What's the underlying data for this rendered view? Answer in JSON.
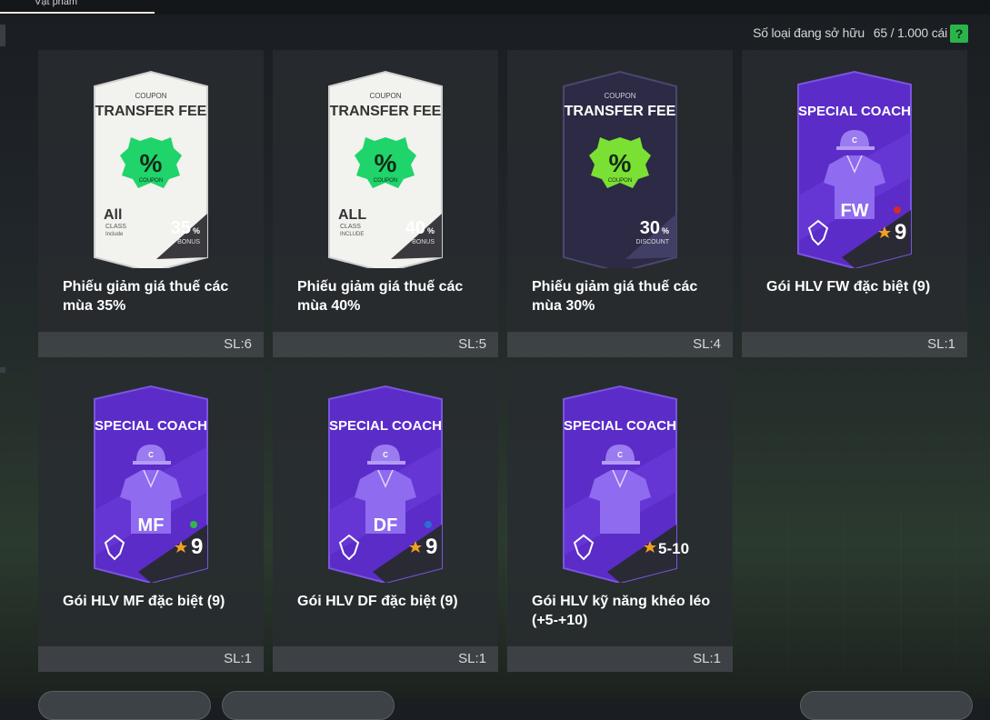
{
  "header": {
    "tab_label": "Vật phẩm"
  },
  "ownership": {
    "label": "Số loại đang sở hữu",
    "count": "65 / 1.000 cái",
    "help_label": "?"
  },
  "items": [
    {
      "title": "Phiếu giảm giá thuế các mùa 35%",
      "qty": "SL:6",
      "art": {
        "kind": "coupon",
        "header": "COUPON",
        "name": "TRANSFER FEE",
        "class_big": "All",
        "class_small": "CLASS",
        "class_small2": "Include",
        "percent": "35",
        "pct_sign": "%",
        "sub": "BONUS",
        "badge_text": "COUPON"
      }
    },
    {
      "title": "Phiếu giảm giá thuế các mùa 40%",
      "qty": "SL:5",
      "art": {
        "kind": "coupon",
        "header": "COUPON",
        "name": "TRANSFER FEE",
        "class_big": "ALL",
        "class_small": "CLASS",
        "class_small2": "INCLUDE",
        "percent": "40",
        "pct_sign": "%",
        "sub": "BONUS",
        "badge_text": "COUPON"
      }
    },
    {
      "title": "Phiếu giảm giá thuế các mùa 30%",
      "qty": "SL:4",
      "art": {
        "kind": "coupon-dark",
        "header": "COUPON",
        "name": "TRANSFER FEE",
        "percent": "30",
        "pct_sign": "%",
        "sub": "DISCOUNT",
        "badge_text": "COUPON"
      }
    },
    {
      "title": "Gói HLV FW đặc biệt (9)",
      "qty": "SL:1",
      "art": {
        "kind": "coach",
        "name": "SPECIAL COACH",
        "position": "FW",
        "level": "9",
        "cap": "C",
        "dot_color": "#d42a2a"
      }
    },
    {
      "title": "Gói HLV MF đặc biệt (9)",
      "qty": "SL:1",
      "art": {
        "kind": "coach",
        "name": "SPECIAL COACH",
        "position": "MF",
        "level": "9",
        "cap": "C",
        "dot_color": "#2fb84a"
      }
    },
    {
      "title": "Gói HLV DF đặc biệt (9)",
      "qty": "SL:1",
      "art": {
        "kind": "coach",
        "name": "SPECIAL COACH",
        "position": "DF",
        "level": "9",
        "cap": "C",
        "dot_color": "#2a6fd4"
      }
    },
    {
      "title": "Gói HLV kỹ năng khéo léo (+5-+10)",
      "qty": "SL:1",
      "art": {
        "kind": "coach",
        "name": "SPECIAL COACH",
        "position": "",
        "level": "5-10",
        "cap": "C",
        "dot_color": ""
      }
    }
  ],
  "colors": {
    "accent_green": "#2bb44a",
    "coach_purple": "#6a35d8",
    "coupon_green": "#1fd46a",
    "star": "#f0a020"
  }
}
